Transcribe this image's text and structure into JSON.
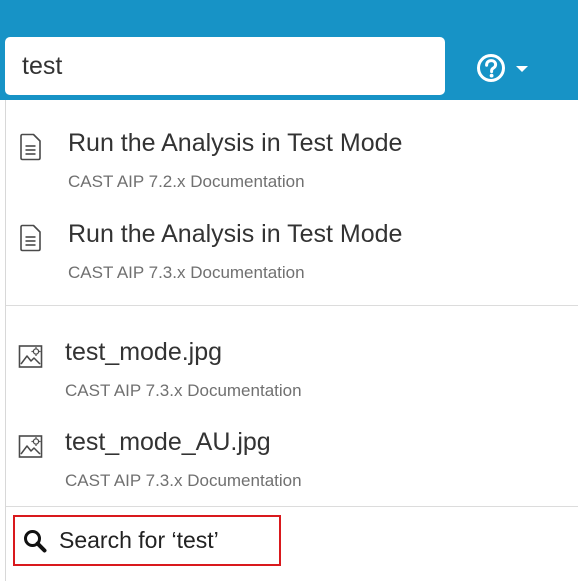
{
  "colors": {
    "accent": "#1793c6",
    "highlight_border": "#d9191d"
  },
  "search": {
    "value": "test"
  },
  "help_menu": {
    "icon": "help-circle-icon",
    "caret_icon": "caret-down-icon"
  },
  "results": [
    {
      "icon": "document-icon",
      "title": "Run the Analysis in Test Mode",
      "source": "CAST AIP 7.2.x Documentation"
    },
    {
      "icon": "document-icon",
      "title": "Run the Analysis in Test Mode",
      "source": "CAST AIP 7.3.x Documentation"
    },
    {
      "icon": "image-file-icon",
      "title": "test_mode.jpg",
      "source": "CAST AIP 7.3.x Documentation"
    },
    {
      "icon": "image-file-icon",
      "title": "test_mode_AU.jpg",
      "source": "CAST AIP 7.3.x Documentation"
    }
  ],
  "search_for": {
    "icon": "search-icon",
    "label": "Search for ‘test’"
  }
}
